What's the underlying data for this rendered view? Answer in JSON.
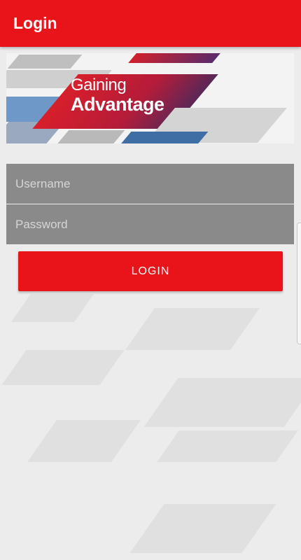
{
  "app_bar": {
    "title": "Login"
  },
  "banner": {
    "line1": "Gaining",
    "line2": "Advantage"
  },
  "form": {
    "username_placeholder": "Username",
    "password_placeholder": "Password",
    "login_label": "LOGIN"
  },
  "colors": {
    "brand_red": "#e8141a",
    "field_gray": "#8a8a8a",
    "background": "#ececec"
  }
}
